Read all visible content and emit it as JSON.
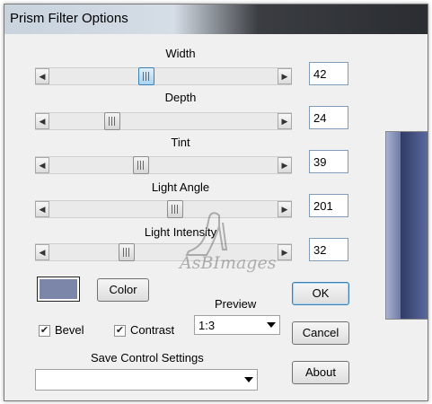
{
  "window": {
    "title": "Prism Filter Options"
  },
  "sliders": [
    {
      "id": "width",
      "label": "Width",
      "value": "42"
    },
    {
      "id": "depth",
      "label": "Depth",
      "value": "24"
    },
    {
      "id": "tint",
      "label": "Tint",
      "value": "39"
    },
    {
      "id": "light_angle",
      "label": "Light Angle",
      "value": "201"
    },
    {
      "id": "light_intensity",
      "label": "Light Intensity",
      "value": "32"
    }
  ],
  "color": {
    "button_label": "Color",
    "swatch": "#7c86a8"
  },
  "preview": {
    "label": "Preview",
    "selected": "1:3"
  },
  "checkboxes": [
    {
      "label": "Bevel",
      "checked": true
    },
    {
      "label": "Contrast",
      "checked": true
    }
  ],
  "save_settings": {
    "label": "Save Control Settings",
    "selected": ""
  },
  "buttons": {
    "ok": "OK",
    "cancel": "Cancel",
    "about": "About"
  },
  "watermark": {
    "text": "AsBImages"
  }
}
